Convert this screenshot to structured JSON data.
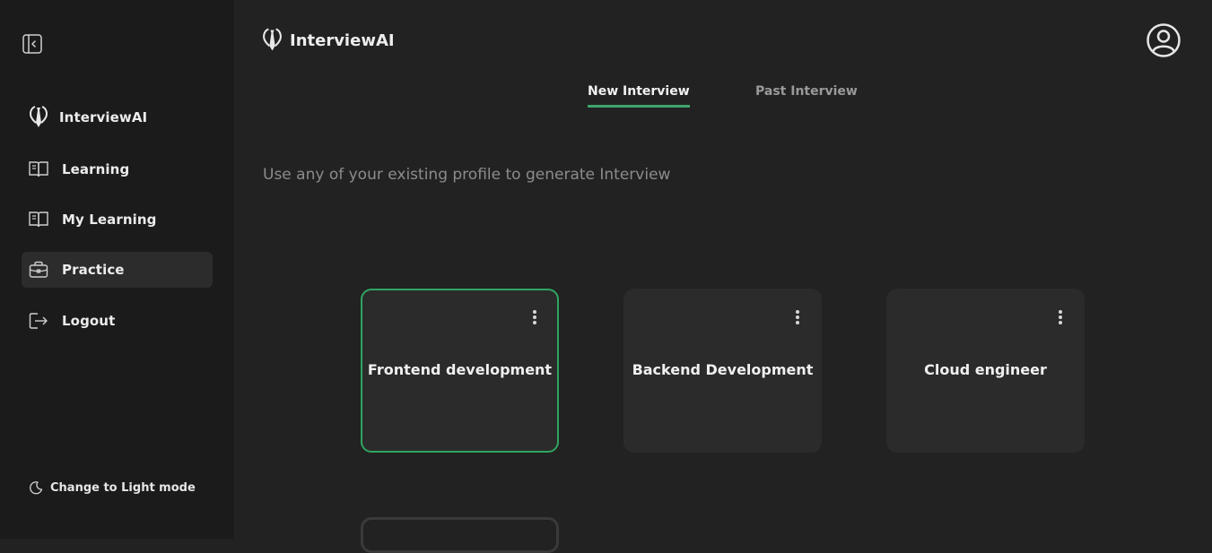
{
  "sidebar": {
    "brand_label": "InterviewAI",
    "items": [
      {
        "label": "Learning",
        "icon": "book-open-icon"
      },
      {
        "label": "My Learning",
        "icon": "book-open-icon"
      },
      {
        "label": "Practice",
        "icon": "briefcase-icon",
        "active": true
      },
      {
        "label": "Logout",
        "icon": "logout-icon"
      }
    ],
    "theme_toggle_label": "Change to Light mode"
  },
  "header": {
    "brand": "InterviewAI"
  },
  "tabs": [
    {
      "label": "New Interview",
      "active": true
    },
    {
      "label": "Past Interview",
      "active": false
    }
  ],
  "main": {
    "subtitle": "Use any of your existing profile to generate Interview",
    "profiles": [
      {
        "title": "Frontend development",
        "selected": true
      },
      {
        "title": "Backend Development",
        "selected": false
      },
      {
        "title": "Cloud engineer",
        "selected": false
      }
    ]
  },
  "colors": {
    "accent": "#2fa561",
    "background": "#222222",
    "sidebar": "#1b1b1b",
    "card": "#2b2b2b"
  }
}
